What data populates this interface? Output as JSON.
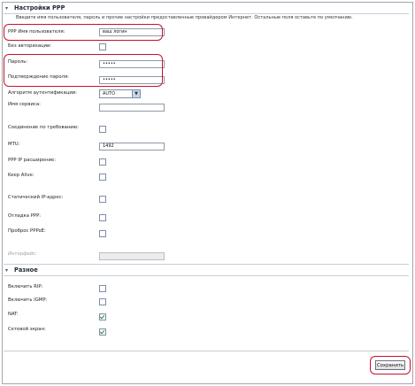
{
  "ppp_section": {
    "title": "Настройки PPP",
    "description": "Введите имя пользователя, пароль и прочие настройки предоставленные провайдером Интернет. Остальные поля оставьте по умолчанию.",
    "username_label": "PPP Имя пользователя:",
    "username_value": "ваш логин",
    "no_auth_label": "Без авторизации:",
    "no_auth_checked": false,
    "password_label": "Пароль:",
    "password_value": "•••••",
    "confirm_password_label": "Подтверждение пароля:",
    "confirm_password_value": "•••••",
    "auth_algo_label": "Алгоритм аутентификации:",
    "auth_algo_value": "AUTO",
    "service_name_label": "Имя сервиса:",
    "service_name_value": "",
    "on_demand_label": "Соединение по требованию:",
    "on_demand_checked": false,
    "mtu_label": "MTU:",
    "mtu_value": "1492",
    "ppp_ip_ext_label": "PPP IP расширение:",
    "ppp_ip_ext_checked": false,
    "keep_alive_label": "Keep Alive:",
    "keep_alive_checked": false,
    "static_ip_label": "Статический IP-адрес:",
    "static_ip_checked": false,
    "ppp_debug_label": "Отладка PPP:",
    "ppp_debug_checked": false,
    "pppoe_passthrough_label": "Проброс PPPoE:",
    "pppoe_passthrough_checked": false,
    "interface_label": "Интерфейс:",
    "interface_value": ""
  },
  "misc_section": {
    "title": "Разное",
    "rip_label": "Включить RIP:",
    "rip_checked": false,
    "igmp_label": "Включить IGMP:",
    "igmp_checked": false,
    "nat_label": "NAT:",
    "nat_checked": true,
    "firewall_label": "Сетевой экран:",
    "firewall_checked": true
  },
  "actions": {
    "save_label": "Сохранить"
  },
  "colors": {
    "highlight": "#c8102e",
    "check": "#2f7d2f"
  }
}
